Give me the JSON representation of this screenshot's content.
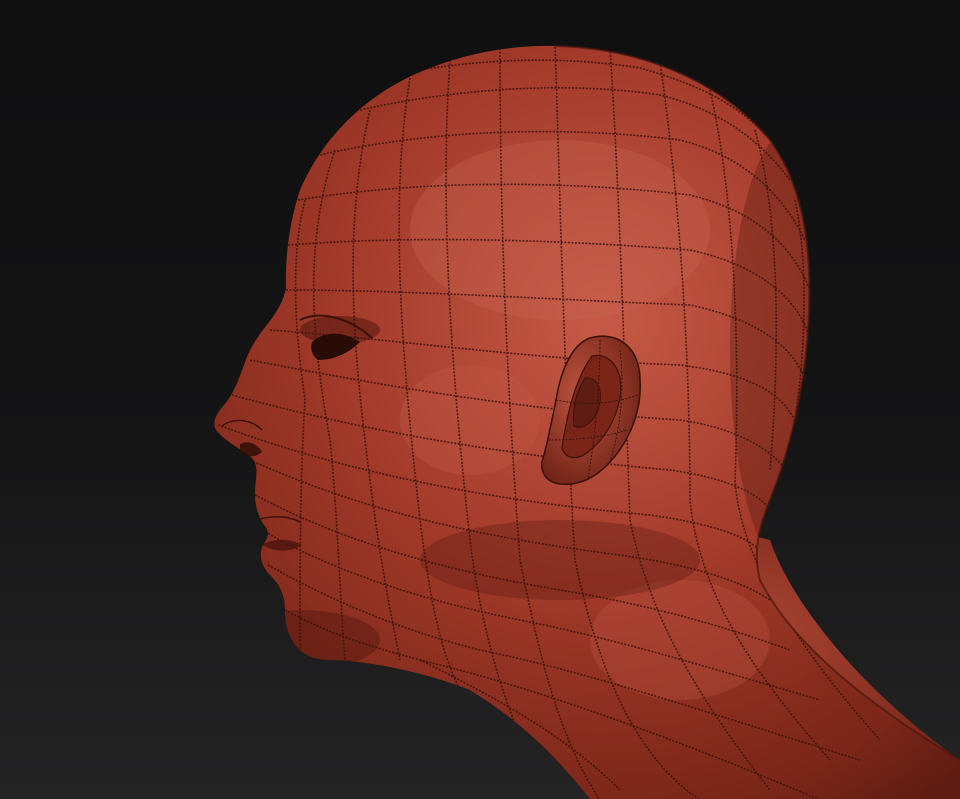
{
  "scene": {
    "subject": "head-mesh",
    "background": {
      "top": "#0f0f10",
      "bottom": "#242425"
    },
    "material": {
      "base": "#a33a2a",
      "highlight": "#c45a48",
      "shadow": "#5e1c12",
      "wire": "#3a120b"
    }
  }
}
